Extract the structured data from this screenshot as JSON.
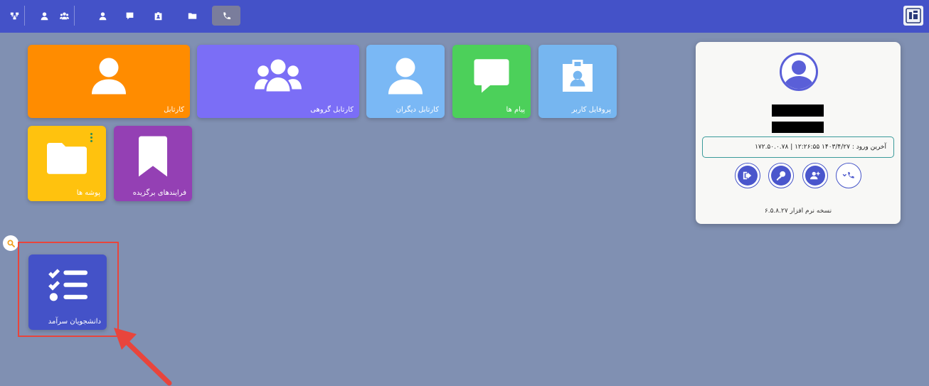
{
  "topbar": {
    "buttons": [
      {
        "name": "network-icon"
      },
      {
        "name": "user-icon"
      },
      {
        "name": "users-group-icon"
      },
      {
        "name": "user-icon"
      },
      {
        "name": "chat-icon"
      },
      {
        "name": "id-badge-icon"
      },
      {
        "name": "folder-icon"
      },
      {
        "name": "phone-icon",
        "active": true
      }
    ],
    "logo": "university-logo"
  },
  "tiles": [
    {
      "label": "کارتابل",
      "color": "#ff8c00",
      "icon": "user-icon"
    },
    {
      "label": "کارتابل گروهی",
      "color": "#7b6ef6",
      "icon": "users-group-icon"
    },
    {
      "label": "کارتابل دیگران",
      "color": "#7ab8f5",
      "icon": "user-icon"
    },
    {
      "label": "پیام ها",
      "color": "#4cd05a",
      "icon": "chat-icon"
    },
    {
      "label": "پروفایل کاربر",
      "color": "#76b6f0",
      "icon": "id-badge-icon"
    },
    {
      "label": "پوشه ها",
      "color": "#ffc20e",
      "icon": "folder-icon"
    },
    {
      "label": "فرایندهای برگزیده",
      "color": "#9440b4",
      "icon": "bookmark-icon"
    },
    {
      "label": "دانشجویان سرآمد",
      "color": "#4452c8",
      "icon": "checklist-icon"
    }
  ],
  "profile": {
    "last_login": "آخرین ورود : ۱۴۰۳/۴/۲۷ ۱۲:۲۶:۵۵ | ۱۷۲.۵۰.۰.۷۸",
    "actions": [
      "logout-icon",
      "key-icon",
      "add-user-icon",
      "phone-dropdown-icon"
    ],
    "version": "نسخه نرم افزار ۶.۵.۸.۲۷"
  },
  "colors": {
    "topbar": "#4452c8",
    "background": "#8090b2",
    "highlight": "#e8453c"
  }
}
